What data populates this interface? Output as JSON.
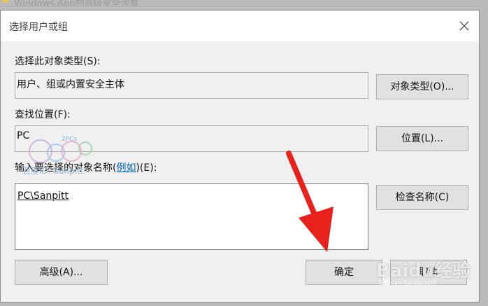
{
  "parent_window": {
    "title": "Windows.App的高级安全设置"
  },
  "dialog": {
    "title": "选择用户或组",
    "object_type": {
      "label": "选择此对象类型(S):",
      "value": "用户、组或内置安全主体",
      "button": "对象类型(O)..."
    },
    "location": {
      "label": "查找位置(F):",
      "value": "PC",
      "button": "位置(L)..."
    },
    "names": {
      "label_prefix": "输入要选择的对象名称(",
      "label_link": "例如",
      "label_suffix": ")(E):",
      "value": "PC\\Sanpitt",
      "check_button": "检查名称(C)"
    },
    "buttons": {
      "advanced": "高级(A)...",
      "ok": "确定",
      "cancel": "取消"
    }
  },
  "watermark": {
    "text": "百度ID: Sanpitt",
    "logo_text": "2PCs"
  },
  "baidu_watermark": {
    "text": "Baidu经验",
    "sub": "jingyan.baidu.com"
  },
  "colors": {
    "arrow": "#e8211c",
    "link": "#0066cc",
    "dialog_bg": "#f0f0f0"
  },
  "icons": {
    "close": "close-icon",
    "arrow": "red-arrow-annotation"
  }
}
